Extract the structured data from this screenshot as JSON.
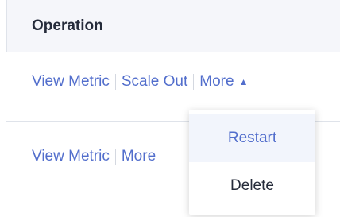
{
  "table": {
    "header": {
      "operation": "Operation"
    },
    "rows": [
      {
        "actions": {
          "view_metric": "View Metric",
          "scale_out": "Scale Out",
          "more": "More",
          "more_caret": "▲"
        }
      },
      {
        "actions": {
          "view_metric": "View Metric",
          "more": "More"
        }
      }
    ]
  },
  "dropdown": {
    "items": [
      {
        "label": "Restart",
        "highlighted": true
      },
      {
        "label": "Delete",
        "highlighted": false
      }
    ]
  },
  "colors": {
    "link": "#526ecc",
    "header_bg": "#f5f6fa",
    "text": "#252b3a",
    "highlight_bg": "#f2f5fc",
    "divider": "#dfe3ea"
  }
}
